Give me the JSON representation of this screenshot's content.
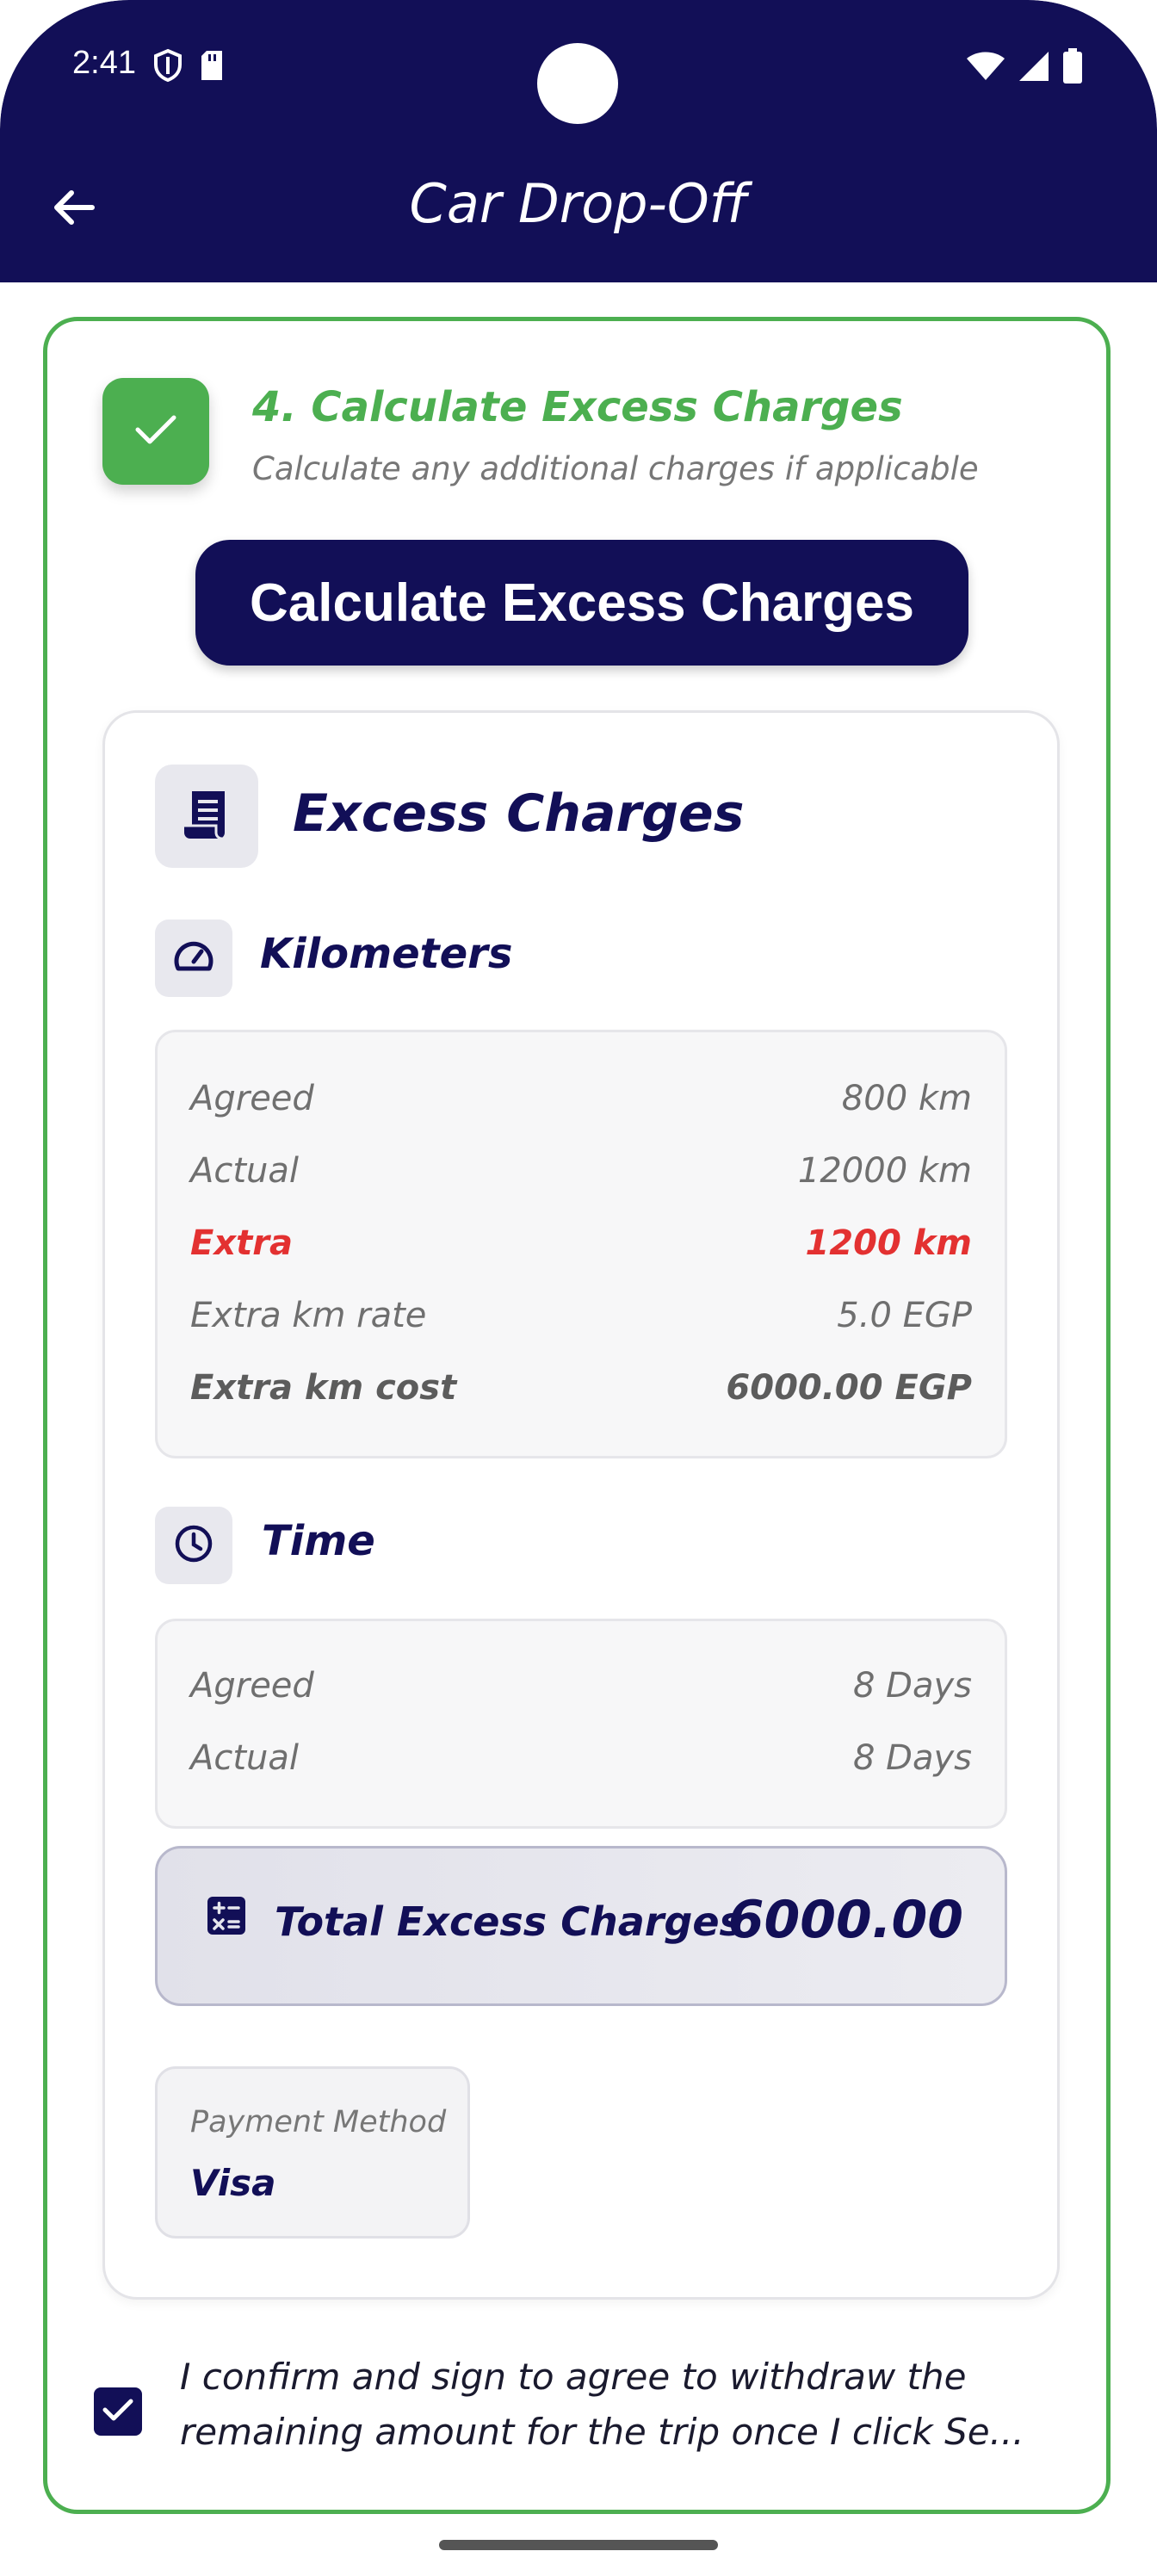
{
  "status_bar": {
    "time": "2:41",
    "icons_left": [
      "shield-icon",
      "sd-card-icon"
    ],
    "icons_right": [
      "wifi-icon",
      "signal-icon",
      "battery-icon"
    ]
  },
  "header": {
    "title": "Car Drop-Off",
    "back_icon": "arrow-left-icon",
    "background": "#120f57"
  },
  "step": {
    "title": "4. Calculate Excess Charges",
    "subtitle": "Calculate any additional charges if applicable",
    "status": "completed",
    "accent": "#4caf50",
    "button_label": "Calculate Excess Charges"
  },
  "excess_charges": {
    "title": "Excess Charges",
    "icon": "receipt-icon",
    "kilometers": {
      "title": "Kilometers",
      "icon": "speedometer-icon",
      "rows": [
        {
          "label": "Agreed",
          "value": "800 km"
        },
        {
          "label": "Actual",
          "value": "12000 km"
        },
        {
          "label": "Extra",
          "value": "1200 km"
        },
        {
          "label": "Extra km rate",
          "value": "5.0 EGP"
        },
        {
          "label": "Extra km cost",
          "value": "6000.00 EGP"
        }
      ]
    },
    "time": {
      "title": "Time",
      "icon": "clock-icon",
      "rows": [
        {
          "label": "Agreed",
          "value": "8 Days"
        },
        {
          "label": "Actual",
          "value": "8 Days"
        }
      ]
    },
    "total": {
      "label": "Total Excess Charges",
      "value": "6000.00",
      "icon": "calculator-icon"
    },
    "payment": {
      "label": "Payment Method",
      "value": "Visa"
    }
  },
  "confirmation": {
    "checked": true,
    "line1": "I confirm and sign to agree to withdraw the",
    "line2": "remaining amount for the trip once I click Se..."
  },
  "colors": {
    "primary": "#120f57",
    "success": "#4caf50",
    "danger": "#e33131"
  }
}
